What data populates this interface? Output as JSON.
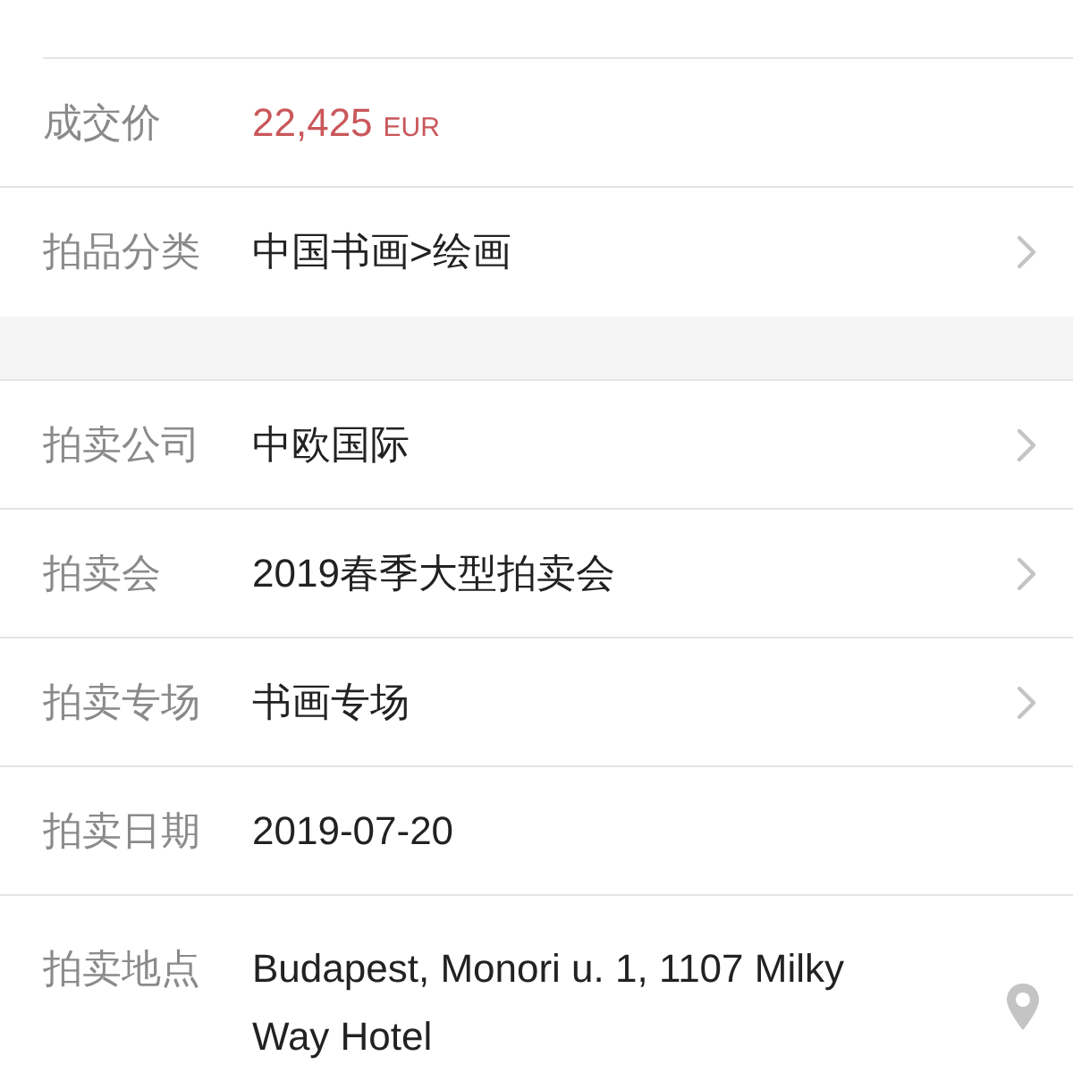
{
  "sections": [
    {
      "rows": [
        {
          "kind": "price",
          "label": "成交价",
          "value": "22,425",
          "unit": "EUR",
          "chevron": false
        },
        {
          "kind": "text",
          "label": "拍品分类",
          "value": "中国书画>绘画",
          "chevron": true
        }
      ]
    },
    {
      "rows": [
        {
          "kind": "text",
          "label": "拍卖公司",
          "value": "中欧国际",
          "chevron": true
        },
        {
          "kind": "text",
          "label": "拍卖会",
          "value": "2019春季大型拍卖会",
          "chevron": true
        },
        {
          "kind": "text",
          "label": "拍卖专场",
          "value": "书画专场",
          "chevron": true
        },
        {
          "kind": "text",
          "label": "拍卖日期",
          "value": "2019-07-20",
          "chevron": false
        },
        {
          "kind": "location",
          "label": "拍卖地点",
          "value": "Budapest, Monori u. 1, 1107 Milky Way Hotel",
          "chevron": false
        }
      ]
    }
  ]
}
